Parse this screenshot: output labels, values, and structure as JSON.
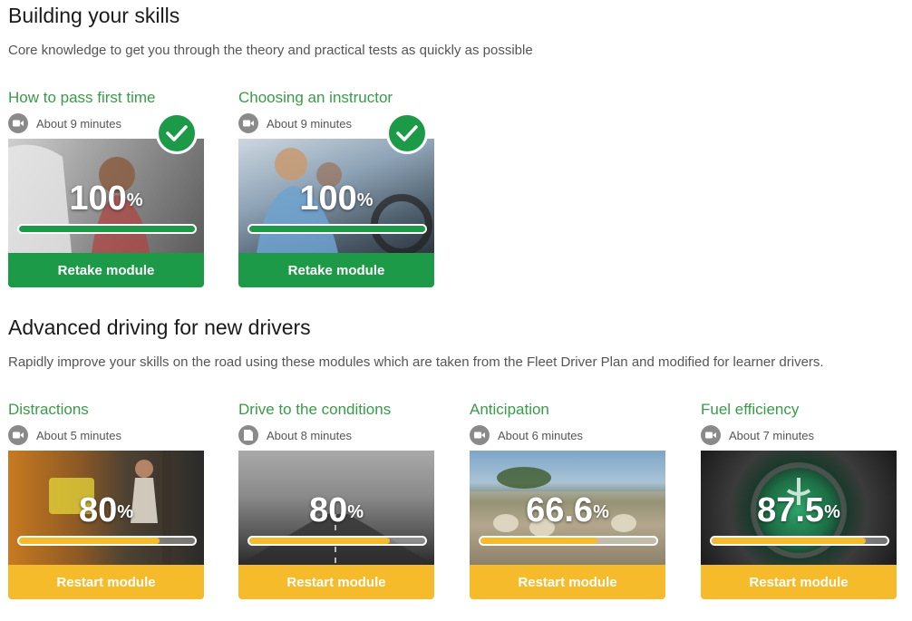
{
  "sections": [
    {
      "title": "Building your skills",
      "description": "Core knowledge to get you through the theory and practical tests as quickly as possible",
      "modules": [
        {
          "title": "How to pass first time",
          "duration": "About 9 minutes",
          "duration_icon": "video-icon",
          "progress_label": "100",
          "progress_percent": 100,
          "button_label": "Retake module",
          "completed": true,
          "accent": "#1c9a48"
        },
        {
          "title": "Choosing an instructor",
          "duration": "About 9 minutes",
          "duration_icon": "video-icon",
          "progress_label": "100",
          "progress_percent": 100,
          "button_label": "Retake module",
          "completed": true,
          "accent": "#1c9a48"
        }
      ]
    },
    {
      "title": "Advanced driving for new drivers",
      "description": "Rapidly improve your skills on the road using these modules which are taken from the Fleet Driver Plan and modified for learner drivers.",
      "modules": [
        {
          "title": "Distractions",
          "duration": "About 5 minutes",
          "duration_icon": "video-icon",
          "progress_label": "80",
          "progress_percent": 80,
          "button_label": "Restart module",
          "completed": false,
          "accent": "#f6bb2a"
        },
        {
          "title": "Drive to the conditions",
          "duration": "About 8 minutes",
          "duration_icon": "document-icon",
          "progress_label": "80",
          "progress_percent": 80,
          "button_label": "Restart module",
          "completed": false,
          "accent": "#f6bb2a"
        },
        {
          "title": "Anticipation",
          "duration": "About 6 minutes",
          "duration_icon": "video-icon",
          "progress_label": "66.6",
          "progress_percent": 66.6,
          "button_label": "Restart module",
          "completed": false,
          "accent": "#f6bb2a"
        },
        {
          "title": "Fuel efficiency",
          "duration": "About 7 minutes",
          "duration_icon": "video-icon",
          "progress_label": "87.5",
          "progress_percent": 87.5,
          "button_label": "Restart module",
          "completed": false,
          "accent": "#f6bb2a"
        }
      ]
    }
  ],
  "percent_symbol": "%"
}
